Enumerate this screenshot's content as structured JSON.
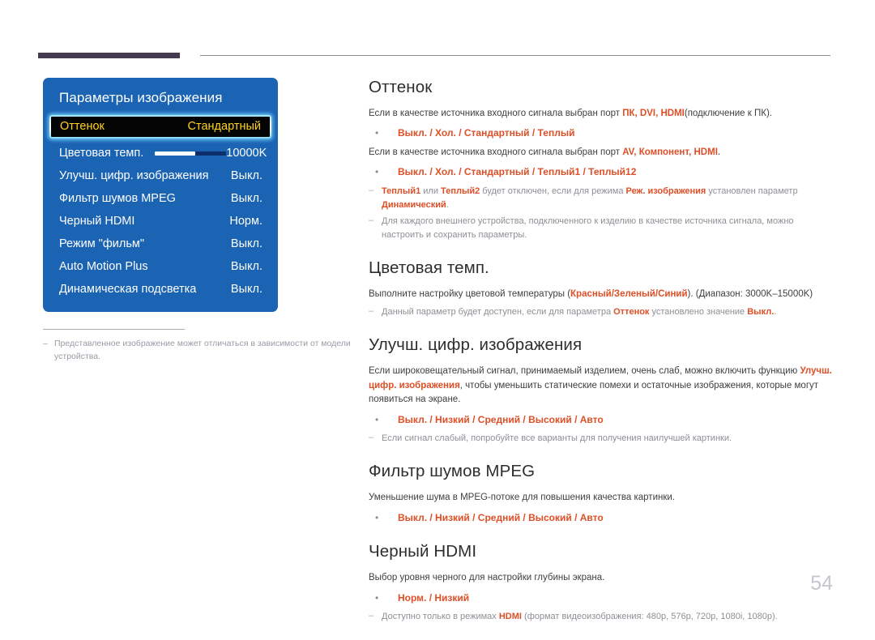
{
  "page": {
    "number": "54"
  },
  "osd": {
    "title": "Параметры изображения",
    "highlighted_row": {
      "label": "Оттенок",
      "value": "Стандартный"
    },
    "rows": [
      {
        "label": "Цветовая темп.",
        "value": "10000K",
        "has_slider": true,
        "slider_percent": 57
      },
      {
        "label": "Улучш. цифр. изображения",
        "value": "Выкл."
      },
      {
        "label": "Фильтр шумов MPEG",
        "value": "Выкл."
      },
      {
        "label": "Черный HDMI",
        "value": "Норм."
      },
      {
        "label": "Режим \"фильм\"",
        "value": "Выкл."
      },
      {
        "label": "Auto Motion Plus",
        "value": "Выкл."
      },
      {
        "label": "Динамическая подсветка",
        "value": "Выкл."
      }
    ],
    "footnote": {
      "dash": "‒",
      "text": "Представленное изображение может отличаться в зависимости от модели устройства."
    }
  },
  "sections": {
    "tint": {
      "title": "Оттенок",
      "para1_pre": "Если в качестве источника входного сигнала выбран порт ",
      "para1_terms": "ПК, DVI, HDMI",
      "para1_post": "(подключение к ПК).",
      "options1": "Выкл. / Хол. / Стандартный / Теплый",
      "para2_pre": "Если в качестве источника входного сигнала выбран порт ",
      "para2_terms": "AV, Компонент, HDMI",
      "para2_post": ".",
      "options2": "Выкл. / Хол. / Стандартный / Теплый1 / Теплый12",
      "note1": {
        "dash": "‒",
        "a": "Теплый1",
        "b": " или ",
        "c": "Теплый2",
        "d": " будет отключен, если для режима ",
        "e": "Реж. изображения",
        "f": " установлен параметр ",
        "g": "Динамический",
        "h": "."
      },
      "note2": {
        "dash": "‒",
        "text": "Для каждого внешнего устройства, подключенного к изделию в качестве источника сигнала, можно настроить и сохранить параметры."
      }
    },
    "color_temp": {
      "title": "Цветовая темп.",
      "para_pre": "Выполните настройку цветовой температуры (",
      "para_terms": "Красный/Зеленый/Синий",
      "para_post": "). (Диапазон: 3000K–15000K)",
      "note": {
        "dash": "‒",
        "a": "Данный параметр будет доступен, если для параметра ",
        "b": "Оттенок",
        "c": " установлено значение ",
        "d": "Выкл.",
        "e": "."
      }
    },
    "digital_clean": {
      "title": "Улучш. цифр. изображения",
      "para_a": "Если широковещательный сигнал, принимаемый изделием, очень слаб, можно включить функцию ",
      "para_b": "Улучш. цифр. изображения",
      "para_c": ", чтобы уменьшить статические помехи и остаточные изображения, которые могут появиться на экране.",
      "options": "Выкл. / Низкий / Средний / Высокий / Авто",
      "note": {
        "dash": "‒",
        "text": "Если сигнал слабый, попробуйте все варианты для получения наилучшей картинки."
      }
    },
    "mpeg_filter": {
      "title": "Фильтр шумов MPEG",
      "para": "Уменьшение шума в MPEG-потоке для повышения качества картинки.",
      "options": "Выкл. / Низкий / Средний / Высокий / Авто"
    },
    "hdmi_black": {
      "title": "Черный HDMI",
      "para": "Выбор уровня черного для настройки глубины экрана.",
      "options": "Норм. / Низкий",
      "note": {
        "dash": "‒",
        "a": "Доступно только в режимах ",
        "b": "HDMI",
        "c": " (формат видеоизображения: 480p, 576p, 720p, 1080i, 1080p)."
      }
    }
  },
  "bullet_glyph": "•",
  "colors": {
    "accent": "#de4f27",
    "osd_blue": "#1b63b3",
    "highlight_text": "#ffd21e",
    "header_bar": "#463a4f"
  }
}
